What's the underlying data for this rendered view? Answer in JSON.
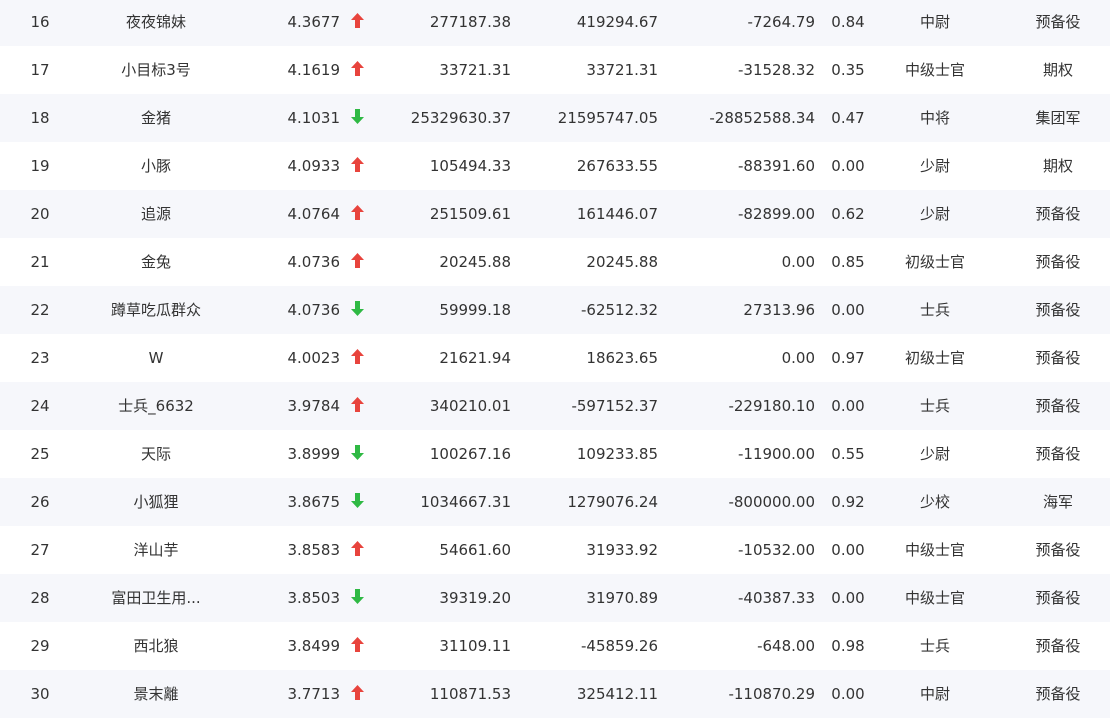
{
  "colors": {
    "up": "#e8443d",
    "down": "#2fb944",
    "stripe": "#f6f7fb"
  },
  "rows": [
    {
      "rank": "16",
      "name": "夜夜锦妹",
      "score": "4.3677",
      "trend": "up",
      "v1": "277187.38",
      "v2": "419294.67",
      "v3": "-7264.79",
      "ratio": "0.84",
      "level": "中尉",
      "type": "预备役"
    },
    {
      "rank": "17",
      "name": "小目标3号",
      "score": "4.1619",
      "trend": "up",
      "v1": "33721.31",
      "v2": "33721.31",
      "v3": "-31528.32",
      "ratio": "0.35",
      "level": "中级士官",
      "type": "期权"
    },
    {
      "rank": "18",
      "name": "金猪",
      "score": "4.1031",
      "trend": "down",
      "v1": "25329630.37",
      "v2": "21595747.05",
      "v3": "-28852588.34",
      "ratio": "0.47",
      "level": "中将",
      "type": "集团军"
    },
    {
      "rank": "19",
      "name": "小豚",
      "score": "4.0933",
      "trend": "up",
      "v1": "105494.33",
      "v2": "267633.55",
      "v3": "-88391.60",
      "ratio": "0.00",
      "level": "少尉",
      "type": "期权"
    },
    {
      "rank": "20",
      "name": "追源",
      "score": "4.0764",
      "trend": "up",
      "v1": "251509.61",
      "v2": "161446.07",
      "v3": "-82899.00",
      "ratio": "0.62",
      "level": "少尉",
      "type": "预备役"
    },
    {
      "rank": "21",
      "name": "金兔",
      "score": "4.0736",
      "trend": "up",
      "v1": "20245.88",
      "v2": "20245.88",
      "v3": "0.00",
      "ratio": "0.85",
      "level": "初级士官",
      "type": "预备役"
    },
    {
      "rank": "22",
      "name": "蹲草吃瓜群众",
      "score": "4.0736",
      "trend": "down",
      "v1": "59999.18",
      "v2": "-62512.32",
      "v3": "27313.96",
      "ratio": "0.00",
      "level": "士兵",
      "type": "预备役"
    },
    {
      "rank": "23",
      "name": "W",
      "score": "4.0023",
      "trend": "up",
      "v1": "21621.94",
      "v2": "18623.65",
      "v3": "0.00",
      "ratio": "0.97",
      "level": "初级士官",
      "type": "预备役"
    },
    {
      "rank": "24",
      "name": "士兵_6632",
      "score": "3.9784",
      "trend": "up",
      "v1": "340210.01",
      "v2": "-597152.37",
      "v3": "-229180.10",
      "ratio": "0.00",
      "level": "士兵",
      "type": "预备役"
    },
    {
      "rank": "25",
      "name": "天际",
      "score": "3.8999",
      "trend": "down",
      "v1": "100267.16",
      "v2": "109233.85",
      "v3": "-11900.00",
      "ratio": "0.55",
      "level": "少尉",
      "type": "预备役"
    },
    {
      "rank": "26",
      "name": "小狐狸",
      "score": "3.8675",
      "trend": "down",
      "v1": "1034667.31",
      "v2": "1279076.24",
      "v3": "-800000.00",
      "ratio": "0.92",
      "level": "少校",
      "type": "海军"
    },
    {
      "rank": "27",
      "name": "洋山芋",
      "score": "3.8583",
      "trend": "up",
      "v1": "54661.60",
      "v2": "31933.92",
      "v3": "-10532.00",
      "ratio": "0.00",
      "level": "中级士官",
      "type": "预备役"
    },
    {
      "rank": "28",
      "name": "富田卫生用...",
      "score": "3.8503",
      "trend": "down",
      "v1": "39319.20",
      "v2": "31970.89",
      "v3": "-40387.33",
      "ratio": "0.00",
      "level": "中级士官",
      "type": "预备役"
    },
    {
      "rank": "29",
      "name": "西北狼",
      "score": "3.8499",
      "trend": "up",
      "v1": "31109.11",
      "v2": "-45859.26",
      "v3": "-648.00",
      "ratio": "0.98",
      "level": "士兵",
      "type": "预备役"
    },
    {
      "rank": "30",
      "name": "景末離",
      "score": "3.7713",
      "trend": "up",
      "v1": "110871.53",
      "v2": "325412.11",
      "v3": "-110870.29",
      "ratio": "0.00",
      "level": "中尉",
      "type": "预备役"
    }
  ]
}
